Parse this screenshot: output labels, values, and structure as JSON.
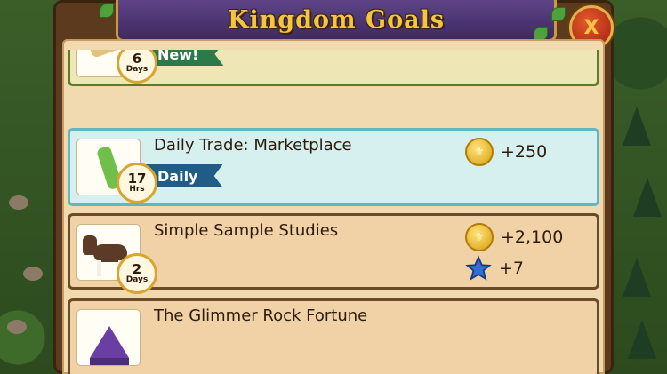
{
  "dialog": {
    "title": "Kingdom Goals",
    "close_label": "X"
  },
  "goals": [
    {
      "title": "",
      "tag": "New!",
      "timer": {
        "value": "6",
        "unit": "Days"
      }
    },
    {
      "title": "Daily Trade: Marketplace",
      "tag": "Daily",
      "timer": {
        "value": "17",
        "unit": "Hrs"
      },
      "rewards": [
        {
          "type": "coin",
          "amount": "+250"
        }
      ]
    },
    {
      "title": "Simple Sample Studies",
      "timer": {
        "value": "2",
        "unit": "Days"
      },
      "rewards": [
        {
          "type": "coin",
          "amount": "+2,100"
        },
        {
          "type": "star",
          "amount": "+7"
        }
      ]
    },
    {
      "title": "The Glimmer Rock Fortune"
    }
  ],
  "colors": {
    "banner": "#4b3370",
    "title_gold": "#f6c443",
    "daily_ribbon": "#1f5c86",
    "new_ribbon": "#2c7a4a"
  }
}
